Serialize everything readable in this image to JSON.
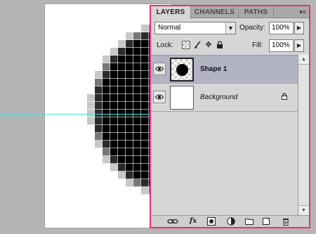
{
  "tabs": [
    {
      "label": "LAYERS",
      "active": true
    },
    {
      "label": "CHANNELS",
      "active": false
    },
    {
      "label": "PATHS",
      "active": false
    }
  ],
  "blend_mode": {
    "value": "Normal"
  },
  "opacity": {
    "label": "Opacity:",
    "value": "100%"
  },
  "lock": {
    "label": "Lock:",
    "icons": [
      "lock-transparent-pixels-icon",
      "lock-image-pixels-icon",
      "lock-position-icon",
      "lock-all-icon"
    ]
  },
  "fill": {
    "label": "Fill:",
    "value": "100%"
  },
  "layers": [
    {
      "name": "Shape 1",
      "visible": true,
      "selected": true
    },
    {
      "name": "Background",
      "visible": true,
      "selected": false,
      "locked": true
    }
  ],
  "bottom_icons": [
    "link-layers-icon",
    "fx-icon",
    "add-mask-icon",
    "adjustment-layer-icon",
    "new-group-icon",
    "new-layer-icon",
    "trash-icon"
  ],
  "colors": {
    "panel_highlight": "#e6307d",
    "selected_layer": "#b2b4c4",
    "guide": "#35e6e6"
  }
}
